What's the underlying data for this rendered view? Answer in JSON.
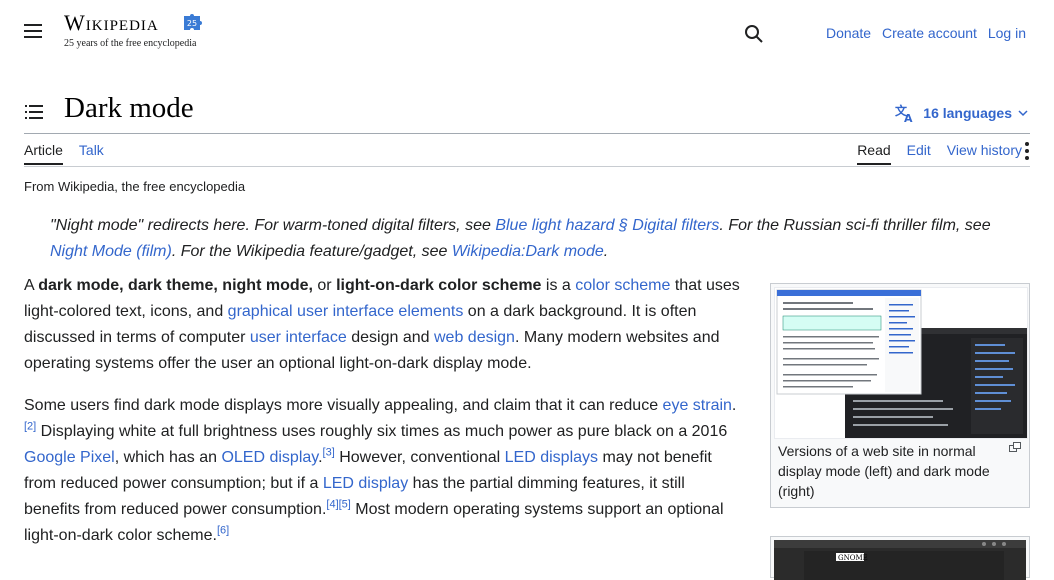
{
  "header": {
    "logo_word": "Wikipedia",
    "logo_tagline": "25 years of the free encyclopedia",
    "user_links": [
      "Donate",
      "Create account",
      "Log in"
    ]
  },
  "title": {
    "text": "Dark mode",
    "languages": "16 languages"
  },
  "tabs": {
    "left": [
      "Article",
      "Talk"
    ],
    "right": [
      "Read",
      "Edit",
      "View history"
    ]
  },
  "tagline": "From Wikipedia, the free encyclopedia",
  "hatnote": {
    "p1": "\"Night mode\" redirects here. For warm-toned digital filters, see ",
    "l1": "Blue light hazard § Digital filters",
    "p2": ". For the Russian sci-fi thriller film, see ",
    "l2": "Night Mode (film)",
    "p3": ". For the Wikipedia feature/gadget, see ",
    "l3": "Wikipedia:Dark mode",
    "p4": "."
  },
  "para1": {
    "t1": "A ",
    "b1": "dark mode, dark theme, night mode,",
    "t2": " or ",
    "b2": "light-on-dark color scheme",
    "t3": " is a ",
    "l1": "color scheme",
    "t4": " that uses light-colored text, icons, and ",
    "l2": "graphical user interface elements",
    "t5": " on a dark background. It is often discussed in terms of computer ",
    "l3": "user interface",
    "t6": " design and ",
    "l4": "web design",
    "t7": ". Many modern websites and operating systems offer the user an optional light-on-dark display mode."
  },
  "para2": {
    "t1": "Some users find dark mode displays more visually appealing, and claim that it can reduce ",
    "l1": "eye strain",
    "s1": "[2]",
    "t2": " Displaying white at full brightness uses roughly six times as much power as pure black on a 2016 ",
    "l2": "Google Pixel",
    "t3": ", which has an ",
    "l3": "OLED display",
    "s2": "[3]",
    "t4": " However, conventional ",
    "l4": "LED displays",
    "t5": " may not benefit from reduced power consumption; but if a ",
    "l5": "LED display",
    "t6": " has the partial dimming features, it still benefits from reduced power consumption.",
    "s3": "[4]",
    "s4": "[5]",
    "t7": " Most modern operating systems support an optional light-on-dark color scheme.",
    "s5": "[6]"
  },
  "figure": {
    "caption": "Versions of a web site in normal display mode (left) and dark mode (right)"
  },
  "figure2": {
    "label": "GNOME"
  }
}
